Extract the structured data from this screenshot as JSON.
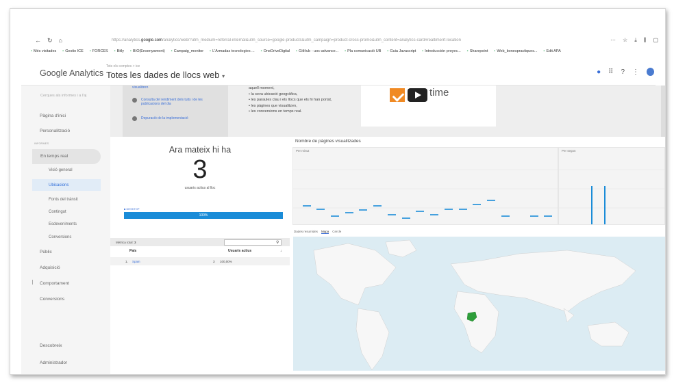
{
  "browser": {
    "url_prefix": "https://analytics.",
    "url_domain": "google.com",
    "url_rest": "/analytics/web/?utm_medium=referral-internal&utm_source=google-products&utm_campaign=product-cross-promo&utm_content=analytics-card#realtime/rt-location",
    "bookmarks": [
      "Més visitades",
      "Gestio ICE",
      "FORCES",
      "Bitly",
      "BIO(Ensenyament)",
      "Campaig_monitor",
      "L'Armadas tecnologies ...",
      "OneDriveDigital",
      "GitHub - uoc-advance...",
      "Pla comunicació UB",
      "Guia Javascript",
      "Introducción proyec...",
      "Sharepoint",
      "Web_bonespractiques...",
      "Edit APA"
    ]
  },
  "header": {
    "logo": "Google Analytics",
    "breadcrumb": "Tots els comptes > ice",
    "view": "Totes les dades de llocs web"
  },
  "sidebar": {
    "search_placeholder": "Cerques als informes i a l'aj",
    "home": "Pàgina d'inici",
    "customization": "Personalització",
    "reports_section": "INFORMES",
    "realtime": "En temps real",
    "realtime_items": [
      "Visió general",
      "Ubicacions",
      "Fonts del trànsit",
      "Contingut",
      "Esdeveniments",
      "Conversions"
    ],
    "audience": "Públic",
    "acquisition": "Adquisició",
    "behavior": "Comportament",
    "conversions": "Conversions",
    "discover": "Descobreix",
    "admin": "Administrador"
  },
  "info": {
    "card_items": [
      "visualitzen",
      "Consulta del rendiment dels tuits i de les publicacions del dia",
      "Depuració de la implementació"
    ],
    "intro": "aquell moment,",
    "bullets": [
      "la seva ubicació geogràfica,",
      "les paraules clau i els llocs que els hi han portat,",
      "les pàgines que visualitzen,",
      "les conversions en temps real."
    ],
    "video_text": "time"
  },
  "active_users": {
    "title": "Ara mateix hi ha",
    "count": "3",
    "subtitle": "usuaris actius al lloc",
    "legend": "DESKTOP",
    "bar_label": "100%"
  },
  "pageviews": {
    "title": "Nombre de pàgines visualitzades",
    "per_minute": "Per minut",
    "per_second": "Per segon"
  },
  "map_tabs": [
    "Dades resumides",
    "Mapa",
    "Cercle"
  ],
  "table": {
    "total_label": "Mètrica total:",
    "total_value": "3",
    "columns": [
      "País",
      "Usuaris actius"
    ],
    "rows": [
      {
        "index": "1.",
        "country": "Spain",
        "users": "3",
        "percent": "100,00%"
      }
    ]
  },
  "colors": {
    "accent": "#3a6fd8",
    "bar": "#1a8cd8",
    "map_highlight": "#2e9e3a"
  }
}
